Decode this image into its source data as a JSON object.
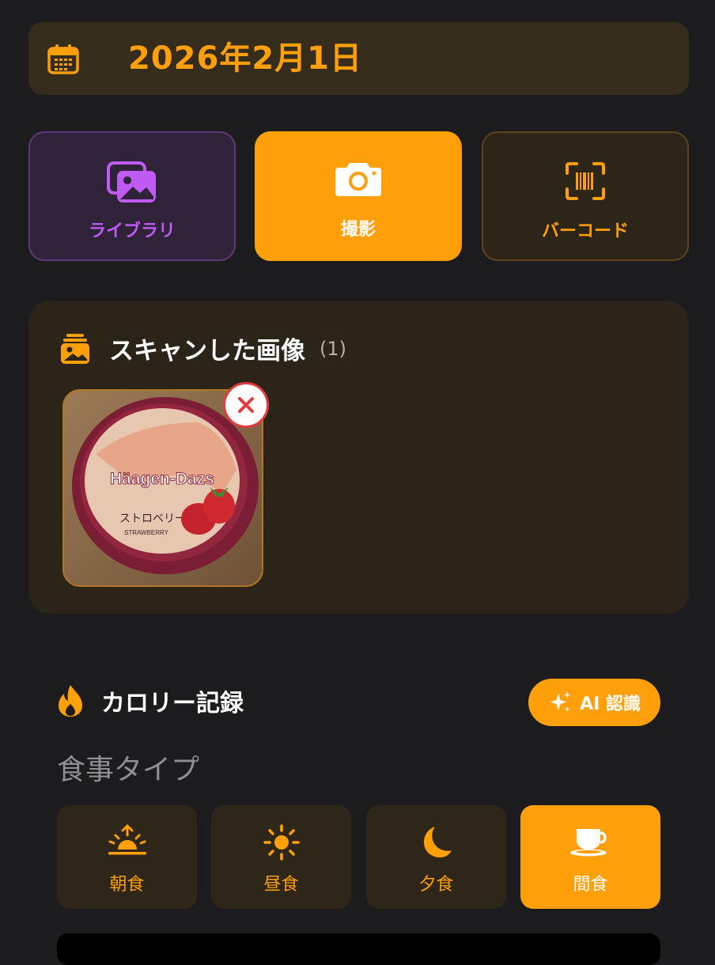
{
  "date": {
    "text": "2026年2月1日",
    "icon": "calendar-icon"
  },
  "sources": [
    {
      "label": "ライブラリ",
      "icon": "photo-library-icon",
      "color": "#bf5af2"
    },
    {
      "label": "撮影",
      "icon": "camera-icon",
      "color": "#ff9f0a",
      "selected": true
    },
    {
      "label": "バーコード",
      "icon": "barcode-scan-icon",
      "color": "#ff9f0a"
    }
  ],
  "scanned": {
    "title": "スキャンした画像",
    "count": "(1)",
    "icon": "stacked-photos-icon",
    "images": [
      {
        "brand": "Häagen-Dazs",
        "flavor_jp": "ストロベリー",
        "flavor_en": "STRAWBERRY"
      }
    ],
    "remove_icon": "close-icon"
  },
  "calorie": {
    "title": "カロリー記録",
    "icon": "flame-icon",
    "ai_button": "AI 認識",
    "ai_icon": "sparkles-icon"
  },
  "meal_type": {
    "title": "食事タイプ",
    "options": [
      {
        "label": "朝食",
        "icon": "sunrise-icon"
      },
      {
        "label": "昼食",
        "icon": "sun-icon"
      },
      {
        "label": "夕食",
        "icon": "moon-icon"
      },
      {
        "label": "間食",
        "icon": "cup-icon",
        "selected": true
      }
    ]
  },
  "colors": {
    "accent": "#ff9f0a",
    "purple": "#bf5af2",
    "background": "#1c1c1e",
    "danger": "#e23b3b"
  }
}
